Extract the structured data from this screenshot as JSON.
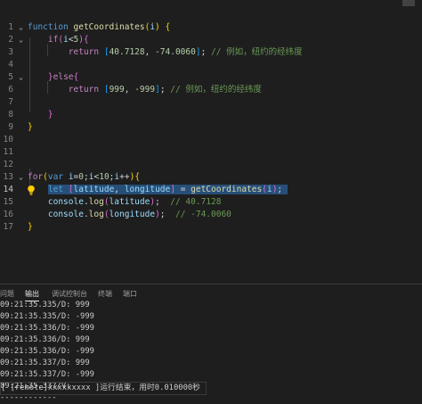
{
  "editor": {
    "line_numbers": [
      "1",
      "2",
      "3",
      "4",
      "5",
      "6",
      "7",
      "8",
      "9",
      "10",
      "11",
      "12",
      "13",
      "14",
      "15",
      "16",
      "17"
    ],
    "lines": {
      "l1": [
        {
          "t": "function",
          "c": "kw"
        },
        {
          "t": " ",
          "c": "pn"
        },
        {
          "t": "getCoordinates",
          "c": "fn"
        },
        {
          "t": "(",
          "c": "br1"
        },
        {
          "t": "i",
          "c": "var"
        },
        {
          "t": ")",
          "c": "br1"
        },
        {
          "t": " {",
          "c": "br1"
        }
      ],
      "l2": [
        {
          "t": "    ",
          "c": "pn"
        },
        {
          "t": "if",
          "c": "kw2"
        },
        {
          "t": "(",
          "c": "br2"
        },
        {
          "t": "i",
          "c": "var"
        },
        {
          "t": "<",
          "c": "pn"
        },
        {
          "t": "5",
          "c": "num"
        },
        {
          "t": ")",
          "c": "br2"
        },
        {
          "t": "{",
          "c": "br2"
        }
      ],
      "l3": [
        {
          "t": "        ",
          "c": "pn"
        },
        {
          "t": "return",
          "c": "kw2"
        },
        {
          "t": " ",
          "c": "pn"
        },
        {
          "t": "[",
          "c": "br3"
        },
        {
          "t": "40.7128",
          "c": "num"
        },
        {
          "t": ", ",
          "c": "pn"
        },
        {
          "t": "-74.0060",
          "c": "num"
        },
        {
          "t": "]",
          "c": "br3"
        },
        {
          "t": "; ",
          "c": "pn"
        },
        {
          "t": "// 例如，纽约的经纬度",
          "c": "cm"
        }
      ],
      "l4": [],
      "l5": [
        {
          "t": "    ",
          "c": "pn"
        },
        {
          "t": "}",
          "c": "br2"
        },
        {
          "t": "else",
          "c": "kw2"
        },
        {
          "t": "{",
          "c": "br2"
        }
      ],
      "l6": [
        {
          "t": "        ",
          "c": "pn"
        },
        {
          "t": "return",
          "c": "kw2"
        },
        {
          "t": " ",
          "c": "pn"
        },
        {
          "t": "[",
          "c": "br3"
        },
        {
          "t": "999",
          "c": "num"
        },
        {
          "t": ", ",
          "c": "pn"
        },
        {
          "t": "-999",
          "c": "num"
        },
        {
          "t": "]",
          "c": "br3"
        },
        {
          "t": "; ",
          "c": "pn"
        },
        {
          "t": "// 例如，纽约的经纬度",
          "c": "cm"
        }
      ],
      "l7": [],
      "l8": [
        {
          "t": "    ",
          "c": "pn"
        },
        {
          "t": "}",
          "c": "br2"
        }
      ],
      "l9": [
        {
          "t": "}",
          "c": "br1"
        }
      ],
      "l10": [],
      "l11": [],
      "l12": [],
      "l13": [
        {
          "t": "for",
          "c": "kw2"
        },
        {
          "t": "(",
          "c": "br1"
        },
        {
          "t": "var",
          "c": "kw"
        },
        {
          "t": " ",
          "c": "pn"
        },
        {
          "t": "i",
          "c": "var"
        },
        {
          "t": "=",
          "c": "pn"
        },
        {
          "t": "0",
          "c": "num"
        },
        {
          "t": ";",
          "c": "pn"
        },
        {
          "t": "i",
          "c": "var"
        },
        {
          "t": "<",
          "c": "pn"
        },
        {
          "t": "10",
          "c": "num"
        },
        {
          "t": ";",
          "c": "pn"
        },
        {
          "t": "i",
          "c": "var"
        },
        {
          "t": "++",
          "c": "pn"
        },
        {
          "t": ")",
          "c": "br1"
        },
        {
          "t": "{",
          "c": "br1"
        }
      ],
      "l14": [
        {
          "t": "    ",
          "c": "pn"
        },
        {
          "t": "let",
          "c": "kw",
          "h": 1
        },
        {
          "t": " ",
          "c": "pn",
          "h": 1
        },
        {
          "t": "[",
          "c": "br2",
          "h": 1
        },
        {
          "t": "latitude",
          "c": "var",
          "h": 1
        },
        {
          "t": ", ",
          "c": "pn",
          "h": 1
        },
        {
          "t": "longitude",
          "c": "var",
          "h": 1
        },
        {
          "t": "]",
          "c": "br2",
          "h": 1
        },
        {
          "t": " = ",
          "c": "pn",
          "h": 1
        },
        {
          "t": "getCoordinates",
          "c": "fn",
          "h": 1
        },
        {
          "t": "(",
          "c": "br2",
          "h": 1
        },
        {
          "t": "i",
          "c": "var",
          "h": 1
        },
        {
          "t": ")",
          "c": "br2",
          "h": 1
        },
        {
          "t": ";",
          "c": "pn",
          "h": 1
        },
        {
          "t": " ",
          "c": "pn",
          "h": 1
        }
      ],
      "l15": [
        {
          "t": "    ",
          "c": "pn"
        },
        {
          "t": "console",
          "c": "var"
        },
        {
          "t": ".",
          "c": "pn"
        },
        {
          "t": "log",
          "c": "fn"
        },
        {
          "t": "(",
          "c": "br2"
        },
        {
          "t": "latitude",
          "c": "var"
        },
        {
          "t": ")",
          "c": "br2"
        },
        {
          "t": ";  ",
          "c": "pn"
        },
        {
          "t": "// 40.7128",
          "c": "cm"
        }
      ],
      "l16": [
        {
          "t": "    ",
          "c": "pn"
        },
        {
          "t": "console",
          "c": "var"
        },
        {
          "t": ".",
          "c": "pn"
        },
        {
          "t": "log",
          "c": "fn"
        },
        {
          "t": "(",
          "c": "br2"
        },
        {
          "t": "longitude",
          "c": "var"
        },
        {
          "t": ")",
          "c": "br2"
        },
        {
          "t": ";  ",
          "c": "pn"
        },
        {
          "t": "// -74.0060",
          "c": "cm"
        }
      ],
      "l17": [
        {
          "t": "}",
          "c": "br1"
        }
      ]
    }
  },
  "panel": {
    "tabs": [
      "问题",
      "输出",
      "调试控制台",
      "终端",
      "端口"
    ],
    "active_tab": "输出",
    "output_lines": [
      "09:21:35.335/D: 999",
      "09:21:35.335/D: -999",
      "09:21:35.336/D: -999",
      "09:21:35.336/D: 999",
      "09:21:35.336/D: -999",
      "09:21:35.337/D: 999",
      "09:21:35.337/D: -999",
      "09:21:35.337/V:",
      "------------",
      "[ [remote]xxxxxxxxx ]运行结束，用时0.010000秒"
    ]
  }
}
